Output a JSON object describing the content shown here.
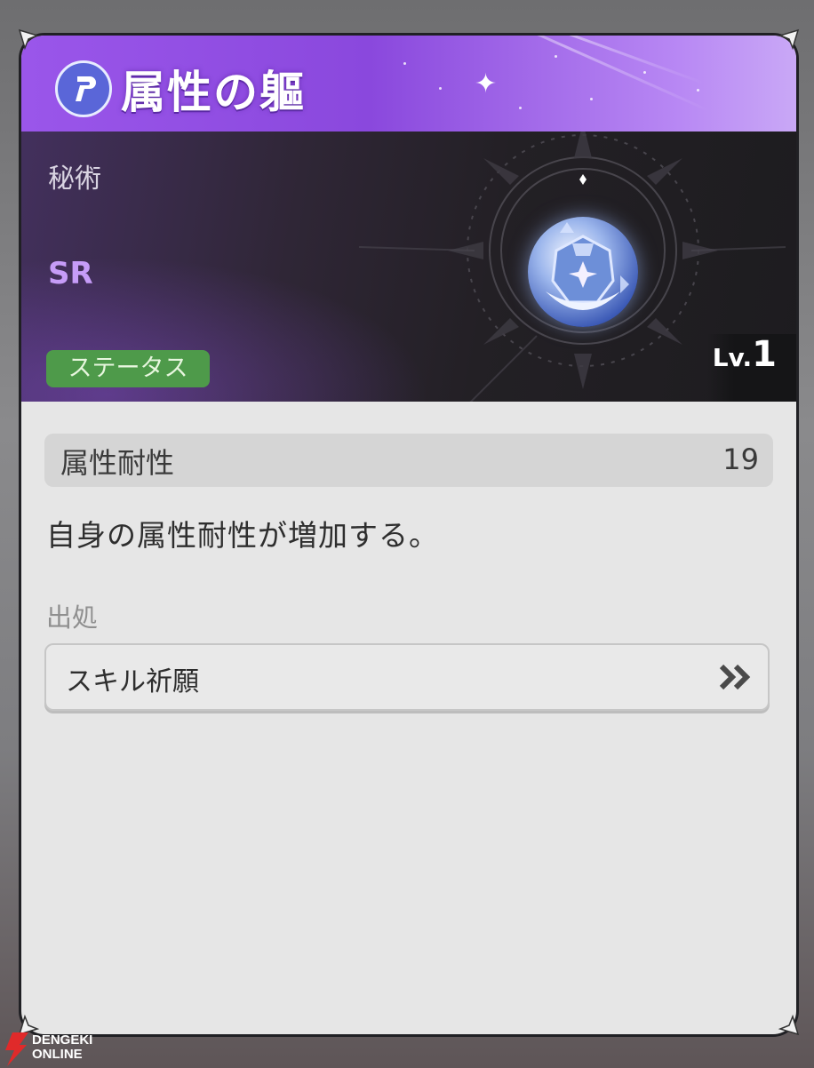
{
  "title_bar": {
    "title": "属性の軀",
    "icon": "p-badge-icon",
    "accent_color": "#9a56ea"
  },
  "hero": {
    "category": "秘術",
    "rarity": "SR",
    "rarity_color": "#c69cf8",
    "type_tag": "ステータス",
    "type_tag_color": "#4e9a4a",
    "level_prefix": "Lv.",
    "level_value": "1",
    "item_icon": "armor-orb-icon"
  },
  "stat": {
    "name": "属性耐性",
    "value": "19"
  },
  "description": "自身の属性耐性が増加する。",
  "source": {
    "label": "出処",
    "button_text": "スキル祈願",
    "button_icon": "double-chevron-right-icon"
  },
  "watermark": {
    "line1": "DENGEKI",
    "line2": "ONLINE"
  }
}
